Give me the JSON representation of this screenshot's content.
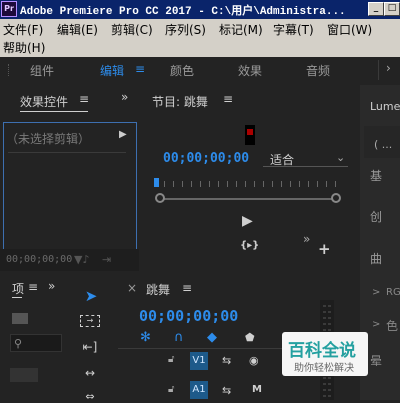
{
  "window": {
    "title": "Adobe Premiere Pro CC 2017 - C:\\用户\\Administra...",
    "app_icon_text": "Pr",
    "minimize_label": "_",
    "restore_label": "□"
  },
  "menu": {
    "items": [
      "文件(F)",
      "编辑(E)",
      "剪辑(C)",
      "序列(S)",
      "标记(M)",
      "字幕(T)",
      "窗口(W)",
      "帮助(H)"
    ]
  },
  "workspace": {
    "tabs": [
      "组件",
      "编辑",
      "颜色",
      "效果",
      "音频"
    ],
    "active_index": 1,
    "menu_icon": "≡"
  },
  "effect_controls": {
    "title": "效果控件",
    "menu_icon": "≡",
    "expand_icon": "»",
    "no_clip_label": "（未选择剪辑）",
    "play_arrow": "▶",
    "timecode": "00;00;00;00"
  },
  "program_monitor": {
    "title": "节目: 跳舞",
    "menu_icon": "≡",
    "timecode": "00;00;00;00",
    "fit_label": "适合",
    "fit_options_icon": "⌄",
    "play_icon": "▶",
    "trim_icon": "{▸}",
    "more_icon": "»",
    "add_icon": "+"
  },
  "lumetri": {
    "title": "Lumet",
    "dropdown": "( ...",
    "sections": [
      "基",
      "创",
      "曲",
      "RG",
      "色",
      "晕"
    ],
    "chevrons": [
      ">",
      ">",
      ">",
      ">",
      ">",
      ">"
    ]
  },
  "project": {
    "title": "项",
    "menu_icon": "≡",
    "expand_icon": "»"
  },
  "tools": {
    "items": [
      "selection-tool",
      "track-select-tool",
      "ripple-edit-tool",
      "razor-tool",
      "slip-tool"
    ]
  },
  "timeline": {
    "close_icon": "×",
    "title": "跳舞",
    "menu_icon": "≡",
    "timecode": "00;00;00;00",
    "tracks": [
      {
        "name": "V1",
        "type": "video"
      },
      {
        "name": "A1",
        "type": "audio",
        "mute_label": "M"
      }
    ]
  },
  "watermark": {
    "title": "百科全说",
    "subtitle": "助你轻松解决"
  },
  "colors": {
    "accent": "#2d8ceb",
    "panel_bg": "#232323",
    "menu_bg": "#d4d0c8",
    "titlebar_bg": "#0a246a"
  }
}
